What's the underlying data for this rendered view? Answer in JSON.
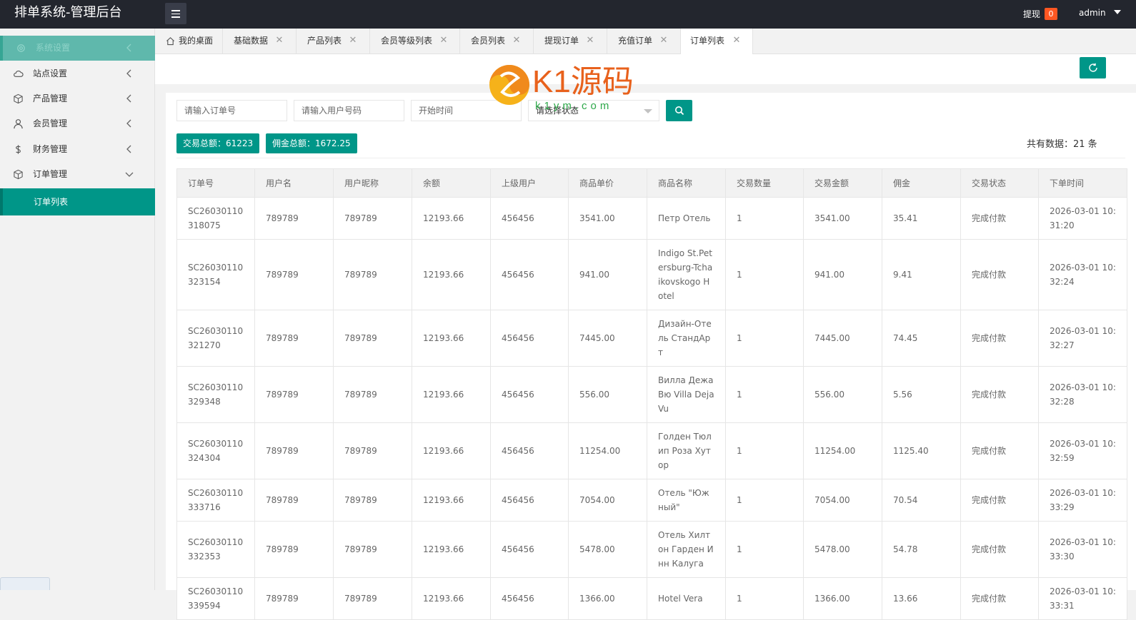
{
  "app": {
    "title": "排单系统-管理后台"
  },
  "header": {
    "withdraw_label": "提现",
    "withdraw_count": "0",
    "user": "admin"
  },
  "sidebar": {
    "items": [
      {
        "label": "系统设置",
        "icon": "gear-icon"
      },
      {
        "label": "站点设置",
        "icon": "cloud-icon"
      },
      {
        "label": "产品管理",
        "icon": "cube-icon"
      },
      {
        "label": "会员管理",
        "icon": "user-icon"
      },
      {
        "label": "财务管理",
        "icon": "dollar-icon"
      },
      {
        "label": "订单管理",
        "icon": "cube-icon"
      }
    ],
    "sub_items": [
      {
        "label": "订单列表"
      }
    ]
  },
  "tabs": [
    {
      "label": "我的桌面"
    },
    {
      "label": "基础数据"
    },
    {
      "label": "产品列表"
    },
    {
      "label": "会员等级列表"
    },
    {
      "label": "会员列表"
    },
    {
      "label": "提现订单"
    },
    {
      "label": "充值订单"
    },
    {
      "label": "订单列表"
    }
  ],
  "filters": {
    "order_no_placeholder": "请输入订单号",
    "phone_placeholder": "请输入用户号码",
    "start_time_placeholder": "开始时间",
    "status_placeholder": "请选择状态"
  },
  "stats": {
    "trade_total": "交易总额：61223",
    "commission_total": "佣金总额：1672.25",
    "record_total": "共有数据：21 条"
  },
  "watermark": {
    "brand": "K1源码",
    "domain": "k1ym.com"
  },
  "table": {
    "headers": [
      "订单号",
      "用户名",
      "用户昵称",
      "余额",
      "上级用户",
      "商品单价",
      "商品名称",
      "交易数量",
      "交易金额",
      "佣金",
      "交易状态",
      "下单时间"
    ],
    "rows": [
      [
        "SC26030110318075",
        "789789",
        "789789",
        "12193.66",
        "456456",
        "3541.00",
        "Петр Отель",
        "1",
        "3541.00",
        "35.41",
        "完成付款",
        "2026-03-01 10:31:20"
      ],
      [
        "SC26030110323154",
        "789789",
        "789789",
        "12193.66",
        "456456",
        "941.00",
        "Indigo St.Petersburg-Tchaikovskogo Hotel",
        "1",
        "941.00",
        "9.41",
        "完成付款",
        "2026-03-01 10:32:24"
      ],
      [
        "SC26030110321270",
        "789789",
        "789789",
        "12193.66",
        "456456",
        "7445.00",
        "Дизайн-Отель СтандАрт",
        "1",
        "7445.00",
        "74.45",
        "完成付款",
        "2026-03-01 10:32:27"
      ],
      [
        "SC26030110329348",
        "789789",
        "789789",
        "12193.66",
        "456456",
        "556.00",
        "Вилла Дежа Вю Villa Deja Vu",
        "1",
        "556.00",
        "5.56",
        "完成付款",
        "2026-03-01 10:32:28"
      ],
      [
        "SC26030110324304",
        "789789",
        "789789",
        "12193.66",
        "456456",
        "11254.00",
        "Голден Тюлип Роза Хутор",
        "1",
        "11254.00",
        "1125.40",
        "完成付款",
        "2026-03-01 10:32:59"
      ],
      [
        "SC26030110333716",
        "789789",
        "789789",
        "12193.66",
        "456456",
        "7054.00",
        "Отель \"Южный\"",
        "1",
        "7054.00",
        "70.54",
        "完成付款",
        "2026-03-01 10:33:29"
      ],
      [
        "SC26030110332353",
        "789789",
        "789789",
        "12193.66",
        "456456",
        "5478.00",
        "Отель Хилтон Гарден Инн Калуга",
        "1",
        "5478.00",
        "54.78",
        "完成付款",
        "2026-03-01 10:33:30"
      ],
      [
        "SC26030110339594",
        "789789",
        "789789",
        "12193.66",
        "456456",
        "1366.00",
        "Hotel Vera",
        "1",
        "1366.00",
        "13.66",
        "完成付款",
        "2026-03-01 10:33:31"
      ]
    ]
  }
}
